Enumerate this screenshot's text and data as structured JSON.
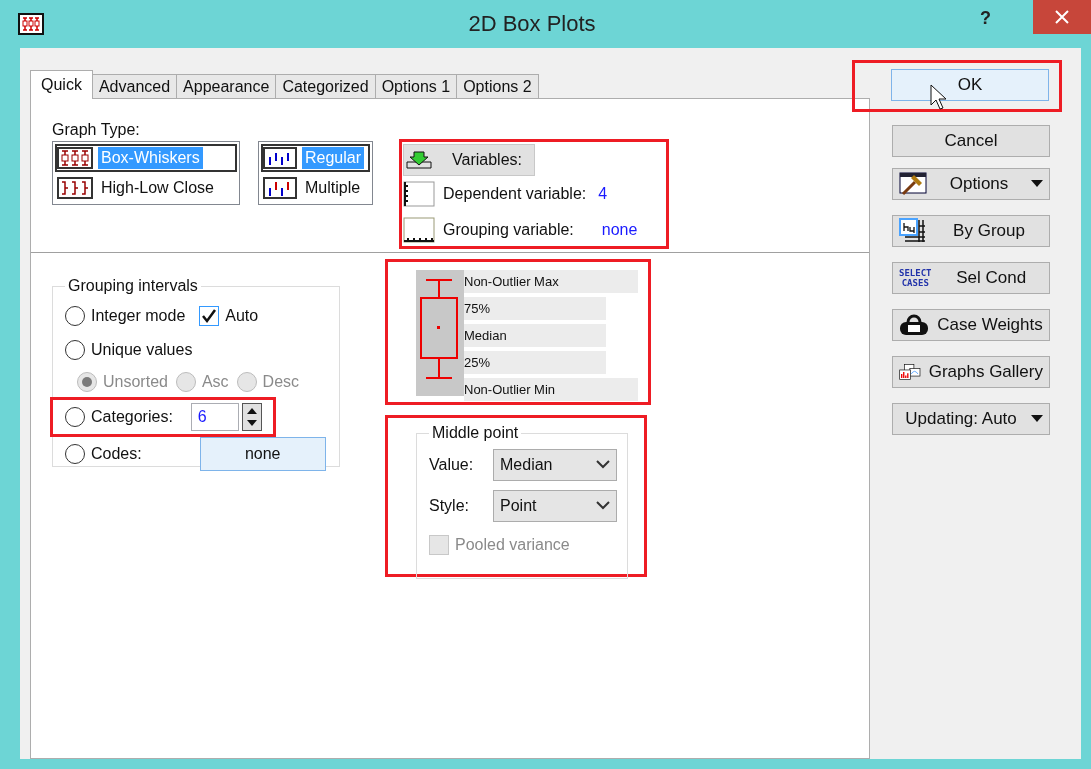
{
  "window": {
    "title": "2D Box Plots",
    "help": "?"
  },
  "tabs": [
    {
      "label": "Quick",
      "selected": true
    },
    {
      "label": "Advanced",
      "selected": false
    },
    {
      "label": "Appearance",
      "selected": false
    },
    {
      "label": "Categorized",
      "selected": false
    },
    {
      "label": "Options 1",
      "selected": false
    },
    {
      "label": "Options 2",
      "selected": false
    }
  ],
  "graph_type": {
    "label": "Graph Type:",
    "types": [
      {
        "label": "Box-Whiskers",
        "selected": true
      },
      {
        "label": "High-Low Close",
        "selected": false
      }
    ],
    "modes": [
      {
        "label": "Regular",
        "selected": true
      },
      {
        "label": "Multiple",
        "selected": false
      }
    ]
  },
  "variables": {
    "highlighted": true,
    "button": "Variables:",
    "dependent": {
      "label": "Dependent variable:",
      "value": "4"
    },
    "grouping": {
      "label": "Grouping variable:",
      "value": "none"
    }
  },
  "grouping_intervals": {
    "title": "Grouping intervals",
    "integer_mode": {
      "label": "Integer mode",
      "selected": false
    },
    "auto": {
      "label": "Auto",
      "checked": true
    },
    "unique_values": {
      "label": "Unique values",
      "selected": false
    },
    "sort_options": [
      {
        "label": "Unsorted",
        "selected": true,
        "disabled": true
      },
      {
        "label": "Asc",
        "selected": false,
        "disabled": true
      },
      {
        "label": "Desc",
        "selected": false,
        "disabled": true
      }
    ],
    "categories": {
      "label": "Categories:",
      "selected": false,
      "value": "6",
      "highlighted": true
    },
    "codes": {
      "label": "Codes:",
      "selected": false,
      "button": "none"
    }
  },
  "box_legend": {
    "highlighted": true,
    "labels": [
      "Non-Outlier Max",
      "75%",
      "Median",
      "25%",
      "Non-Outlier Min"
    ]
  },
  "middle_point": {
    "highlighted": true,
    "title": "Middle point",
    "value": {
      "label": "Value:",
      "selected": "Median"
    },
    "style": {
      "label": "Style:",
      "selected": "Point"
    },
    "pooled_variance": {
      "label": "Pooled variance",
      "checked": false,
      "disabled": true
    }
  },
  "buttons": [
    {
      "label": "OK",
      "kind": "plain",
      "menu": false,
      "highlighted": true,
      "hovered": true
    },
    {
      "label": "Cancel",
      "kind": "plain",
      "menu": false,
      "highlighted": false,
      "hovered": false
    },
    {
      "label": "Options",
      "kind": "hammer",
      "menu": true,
      "highlighted": false,
      "hovered": false
    },
    {
      "label": "By Group",
      "kind": "grid",
      "menu": false,
      "highlighted": false,
      "hovered": false
    },
    {
      "label": "Sel Cond",
      "kind": "select",
      "icon_text": [
        "SELECT",
        "CASES"
      ],
      "menu": false,
      "highlighted": false,
      "hovered": false
    },
    {
      "label": "Case Weights",
      "kind": "weight",
      "menu": false,
      "highlighted": false,
      "hovered": false
    },
    {
      "label": "Graphs Gallery",
      "kind": "gallery",
      "menu": false,
      "highlighted": false,
      "hovered": false
    },
    {
      "label": "Updating: Auto",
      "kind": "plain",
      "menu": true,
      "highlighted": false,
      "hovered": false
    }
  ]
}
